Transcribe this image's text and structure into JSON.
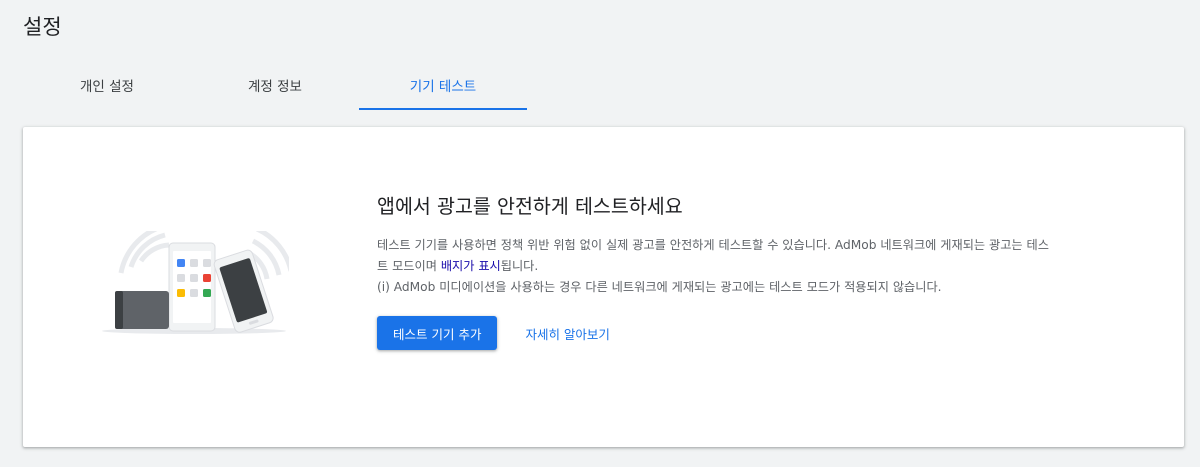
{
  "page": {
    "title": "설정"
  },
  "tabs": [
    {
      "label": "개인 설정",
      "active": false
    },
    {
      "label": "계정 정보",
      "active": false
    },
    {
      "label": "기기 테스트",
      "active": true
    }
  ],
  "card": {
    "headline": "앱에서 광고를 안전하게 테스트하세요",
    "desc_part1": "테스트 기기를 사용하면 정책 위반 위험 없이 실제 광고를 안전하게 테스트할 수 있습니다. AdMob 네트워크에 게재되는 광고는 테스트 모드이며 ",
    "desc_link": "배지가 표시",
    "desc_part2": "됩니다.",
    "desc_line2": "(i) AdMob 미디에이션을 사용하는 경우 다른 네트워크에 게재되는 광고에는 테스트 모드가 적용되지 않습니다.",
    "primary_button": "테스트 기기 추가",
    "learn_more": "자세히 알아보기"
  },
  "illustration": {
    "icon": "test-devices-illustration",
    "app_colors": [
      "#4285f4",
      "#ea4335",
      "#fbbc04",
      "#34a853"
    ]
  },
  "colors": {
    "accent": "#1a73e8",
    "link_visited": "#1a0dab",
    "background": "#f1f3f4"
  }
}
